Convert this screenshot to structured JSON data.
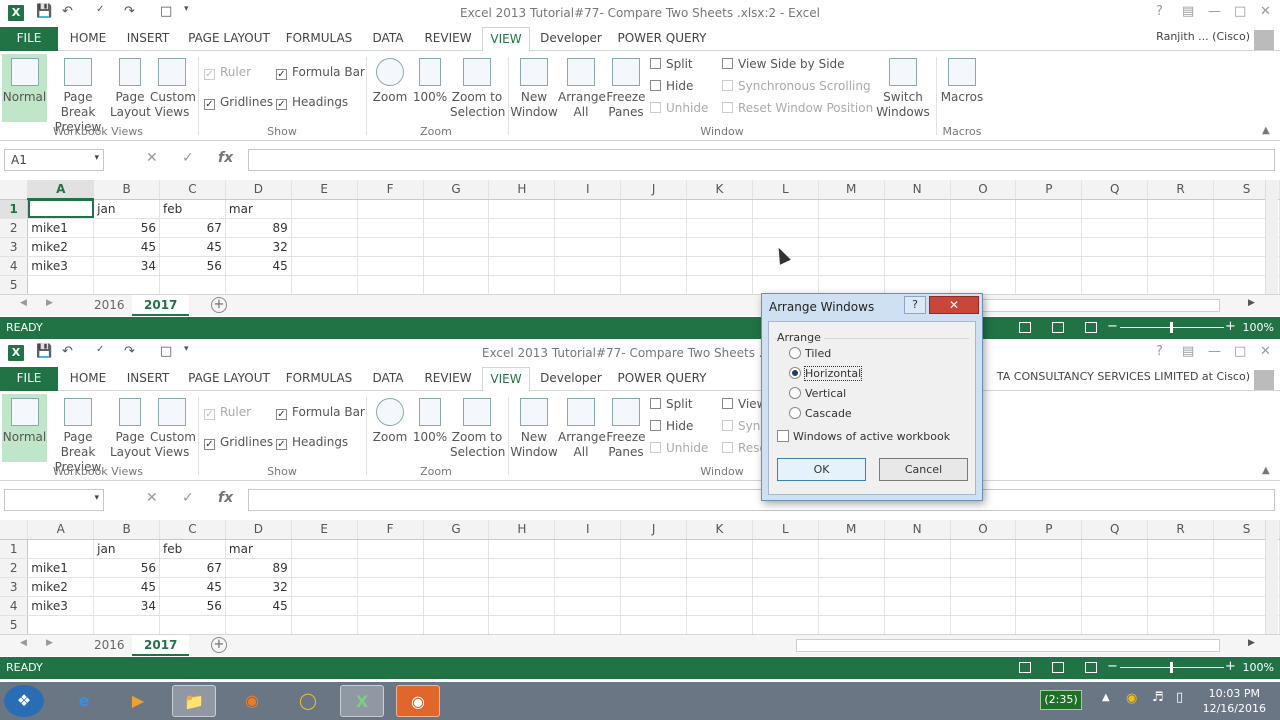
{
  "w1": {
    "title": "Excel 2013 Tutorial#77- Compare Two Sheets .xlsx:2  -  Excel",
    "name_box": "A1",
    "account": "Ranjith ... (Cisco)"
  },
  "w2": {
    "title": "Excel 2013 Tutorial#77- Compare Two Sheets .xlsx:1",
    "name_box": "",
    "account": "TA CONSULTANCY SERVICES LIMITED at Cisco)"
  },
  "tabs": [
    "FILE",
    "HOME",
    "INSERT",
    "PAGE LAYOUT",
    "FORMULAS",
    "DATA",
    "REVIEW",
    "VIEW",
    "Developer",
    "POWER QUERY"
  ],
  "ribbon": {
    "workbook_views": {
      "label": "Workbook Views",
      "normal": "Normal",
      "page_break_1": "Page Break",
      "page_break_2": "Preview",
      "page_layout_1": "Page",
      "page_layout_2": "Layout",
      "custom_1": "Custom",
      "custom_2": "Views"
    },
    "show": {
      "label": "Show",
      "ruler": "Ruler",
      "formula_bar": "Formula Bar",
      "gridlines": "Gridlines",
      "headings": "Headings"
    },
    "zoom": {
      "label": "Zoom",
      "zoom": "Zoom",
      "hundred": "100%",
      "sel_1": "Zoom to",
      "sel_2": "Selection"
    },
    "window": {
      "label": "Window",
      "new_1": "New",
      "new_2": "Window",
      "arrange_1": "Arrange",
      "arrange_2": "All",
      "freeze_1": "Freeze",
      "freeze_2": "Panes",
      "split": "Split",
      "hide": "Hide",
      "unhide": "Unhide",
      "side_by_side": "View Side by Side",
      "sync": "Synchronous Scrolling",
      "reset": "Reset Window Position",
      "switch_1": "Switch",
      "switch_2": "Windows"
    },
    "macros": {
      "label": "Macros",
      "macros": "Macros"
    }
  },
  "fx_label": "fx",
  "columns": [
    "A",
    "B",
    "C",
    "D",
    "E",
    "F",
    "G",
    "H",
    "I",
    "J",
    "K",
    "L",
    "M",
    "N",
    "O",
    "P",
    "Q",
    "R",
    "S"
  ],
  "rows": [
    {
      "n": "1",
      "a": "",
      "b": "jan",
      "c": "feb",
      "d": "mar"
    },
    {
      "n": "2",
      "a": "mike1",
      "b": "56",
      "c": "67",
      "d": "89"
    },
    {
      "n": "3",
      "a": "mike2",
      "b": "45",
      "c": "45",
      "d": "32"
    },
    {
      "n": "4",
      "a": "mike3",
      "b": "34",
      "c": "56",
      "d": "45"
    },
    {
      "n": "5",
      "a": "",
      "b": "",
      "c": "",
      "d": ""
    }
  ],
  "sheets": [
    "2016",
    "2017"
  ],
  "status": {
    "ready": "READY",
    "zoom": "100%"
  },
  "dialog": {
    "title": "Arrange Windows",
    "help": "?",
    "group": "Arrange",
    "options": [
      "Tiled",
      "Horizontal",
      "Vertical",
      "Cascade"
    ],
    "selected": "Horizontal",
    "checkbox": "Windows of active workbook",
    "ok": "OK",
    "cancel": "Cancel"
  },
  "taskbar": {
    "battery": "(2:35)",
    "time": "10:03 PM",
    "date": "12/16/2016"
  }
}
